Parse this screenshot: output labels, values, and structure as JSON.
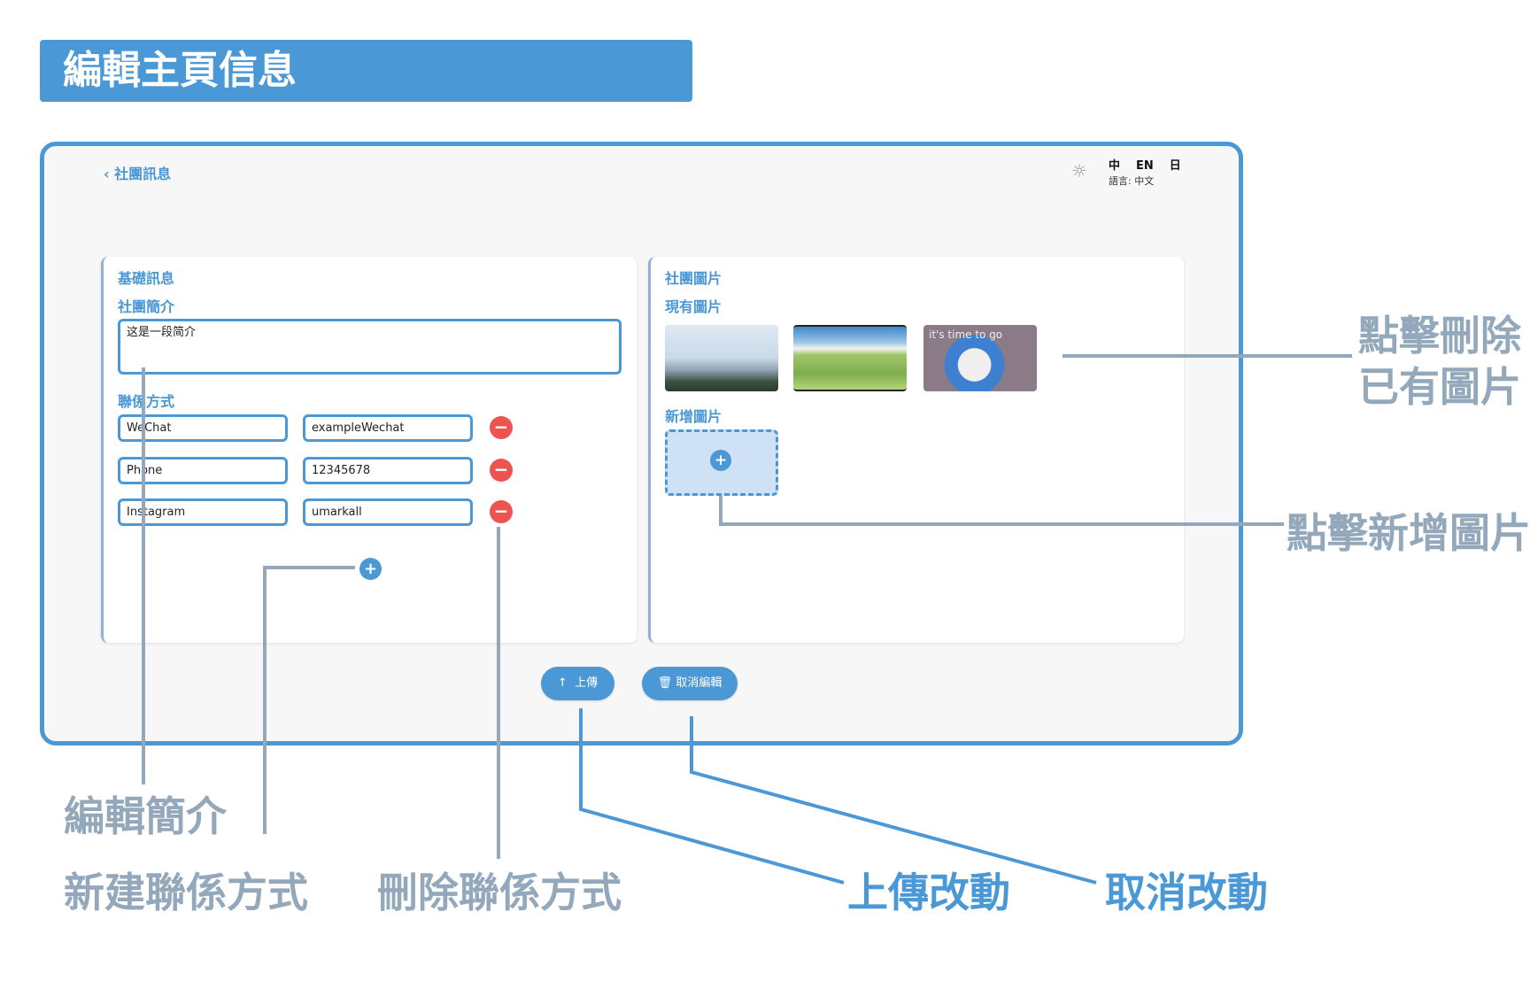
{
  "banner_title": "編輯主頁信息",
  "header": {
    "back_label": "社團訊息",
    "languages": [
      "中",
      "EN",
      "日"
    ],
    "language_label": "語言: 中文",
    "theme_icon": "sun-icon"
  },
  "basic": {
    "section_title": "基礎訊息",
    "intro_label": "社團簡介",
    "intro_value": "这是一段简介",
    "contact_label": "聯係方式",
    "contacts": [
      {
        "type": "WeChat",
        "value": "exampleWechat"
      },
      {
        "type": "Phone",
        "value": "12345678"
      },
      {
        "type": "Instagram",
        "value": "umarkall"
      }
    ]
  },
  "pictures": {
    "section_title": "社團圖片",
    "existing_label": "現有圖片",
    "new_label": "新增圖片",
    "image3_caption": "it's time to go"
  },
  "actions": {
    "upload_label": "上傳",
    "cancel_label": "取消編輯"
  },
  "annotations": {
    "delete_image": [
      "點擊刪除",
      "已有圖片"
    ],
    "add_image": "點擊新增圖片",
    "edit_intro": "編輯簡介",
    "new_contact": "新建聯係方式",
    "delete_contact": "刪除聯係方式",
    "upload_changes": "上傳改動",
    "cancel_changes": "取消改動"
  },
  "colors": {
    "accent": "#4a98d6",
    "danger": "#ef5350",
    "annotation_gray": "#94a8bb"
  }
}
